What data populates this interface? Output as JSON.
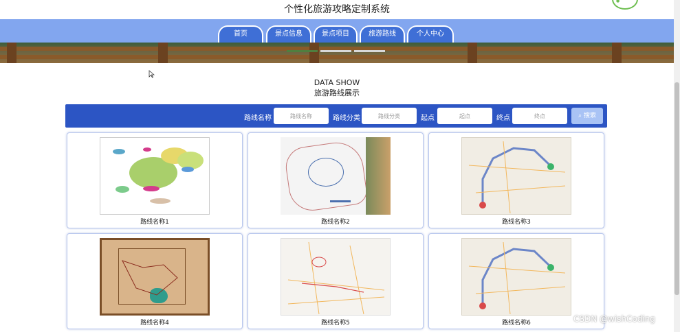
{
  "header": {
    "title": "个性化旅游攻略定制系统"
  },
  "nav": {
    "items": [
      {
        "label": "首页"
      },
      {
        "label": "景点信息"
      },
      {
        "label": "景点项目"
      },
      {
        "label": "旅游路线"
      },
      {
        "label": "个人中心"
      }
    ]
  },
  "section": {
    "title_en": "DATA SHOW",
    "title_cn": "旅游路线展示"
  },
  "search": {
    "fields": [
      {
        "label": "路线名称",
        "placeholder": "路线名称"
      },
      {
        "label": "路线分类",
        "placeholder": "路线分类"
      },
      {
        "label": "起点",
        "placeholder": "起点"
      },
      {
        "label": "终点",
        "placeholder": "终点"
      }
    ],
    "button_label": "搜索"
  },
  "routes": [
    {
      "name": "路线名称1"
    },
    {
      "name": "路线名称2"
    },
    {
      "name": "路线名称3"
    },
    {
      "name": "路线名称4"
    },
    {
      "name": "路线名称5"
    },
    {
      "name": "路线名称6"
    }
  ],
  "watermark": "CSDN @wishCoding",
  "colors": {
    "nav_bg": "#82a6ef",
    "tab_bg": "#3f6fd6",
    "search_bg": "#2c55c4",
    "card_border": "#b9c8ee"
  }
}
